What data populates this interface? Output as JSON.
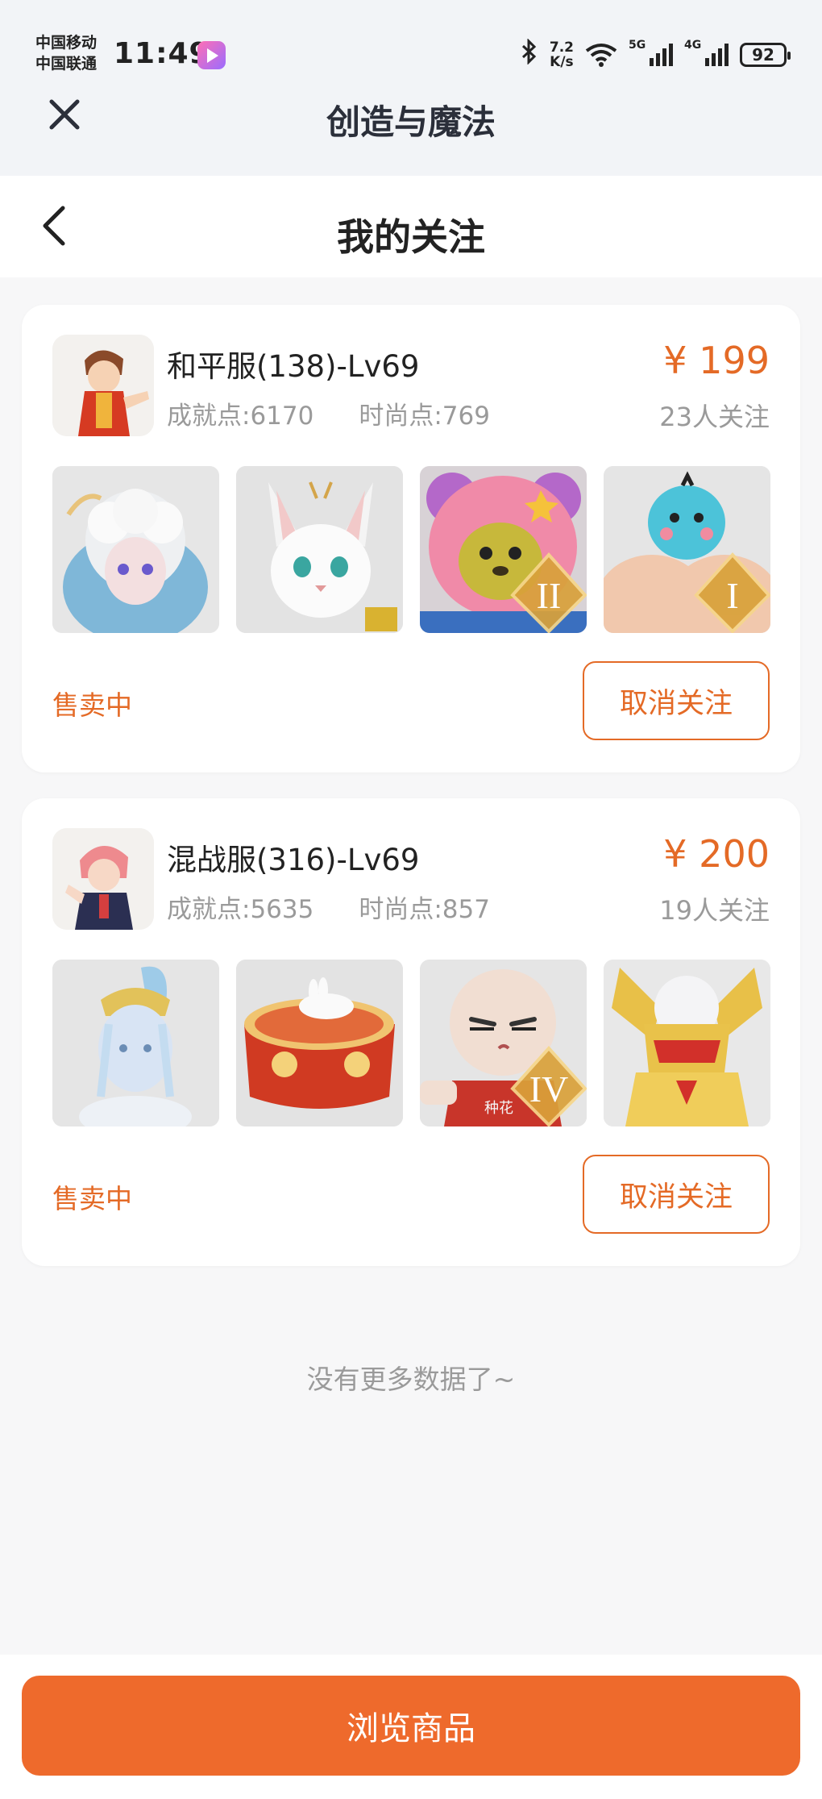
{
  "status_bar": {
    "carrier_1": "中国移动",
    "carrier_2": "中国联通",
    "time": "11:49",
    "net_speed_value": "7.2",
    "net_speed_unit": "K/s",
    "signal_1_label": "5G",
    "signal_2_label": "4G",
    "battery": "92",
    "icons": [
      "play-app-icon",
      "bluetooth-icon",
      "wifi-icon",
      "signal-icon",
      "battery-icon"
    ]
  },
  "app_header": {
    "title": "创造与魔法",
    "close_icon": "close-icon"
  },
  "nav": {
    "title": "我的关注",
    "back_icon": "chevron-left-icon"
  },
  "listings": [
    {
      "server": "和平服(138)-Lv69",
      "achievement": "成就点:6170",
      "fashion": "时尚点:769",
      "price": "¥ 199",
      "follows": "23人关注",
      "status": "售卖中",
      "unfollow_label": "取消关注",
      "items": [
        {
          "name": "cloud-hair-girl",
          "badge": ""
        },
        {
          "name": "white-fox-pet",
          "badge": ""
        },
        {
          "name": "pink-bear-mount",
          "badge": "II"
        },
        {
          "name": "blue-bird-muscle",
          "badge": "I"
        }
      ]
    },
    {
      "server": "混战服(316)-Lv69",
      "achievement": "成就点:5635",
      "fashion": "时尚点:857",
      "price": "¥ 200",
      "follows": "19人关注",
      "status": "售卖中",
      "unfollow_label": "取消关注",
      "items": [
        {
          "name": "fairy-lady",
          "badge": ""
        },
        {
          "name": "red-drum-rabbit",
          "badge": ""
        },
        {
          "name": "bald-head-doll",
          "badge": "IV",
          "shirt_text": "种花"
        },
        {
          "name": "golden-armor",
          "badge": ""
        }
      ]
    }
  ],
  "no_more_text": "没有更多数据了~",
  "bottom_button": "浏览商品",
  "colors": {
    "accent": "#e46a26",
    "button": "#ee6a2c",
    "muted": "#9a9a9a"
  }
}
